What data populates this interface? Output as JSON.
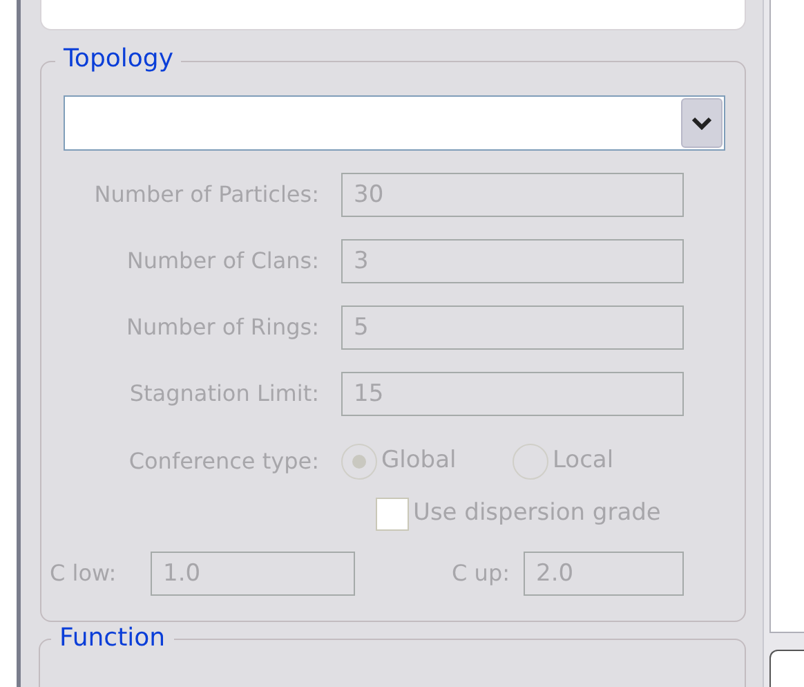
{
  "topology": {
    "title": "Topology",
    "dropdown": {
      "disabled": false
    },
    "fields": [
      {
        "label": "Number of Particles:",
        "value": "30",
        "disabled": true
      },
      {
        "label": "Number of Clans:",
        "value": "3",
        "disabled": true
      },
      {
        "label": "Number of Rings:",
        "value": "5",
        "disabled": true
      },
      {
        "label": "Stagnation Limit:",
        "value": "15",
        "disabled": true
      }
    ],
    "conference": {
      "label": "Conference type:",
      "disabled": true,
      "options": [
        {
          "label": "Global",
          "selected": true
        },
        {
          "label": "Local",
          "selected": false
        }
      ]
    },
    "dispersion": {
      "label": "Use dispersion grade",
      "checked": false,
      "disabled": true
    },
    "c_low": {
      "label": "C low:",
      "value": "1.0",
      "disabled": true
    },
    "c_up": {
      "label": "C up:",
      "value": "2.0",
      "disabled": true
    }
  },
  "function": {
    "title": "Function"
  }
}
